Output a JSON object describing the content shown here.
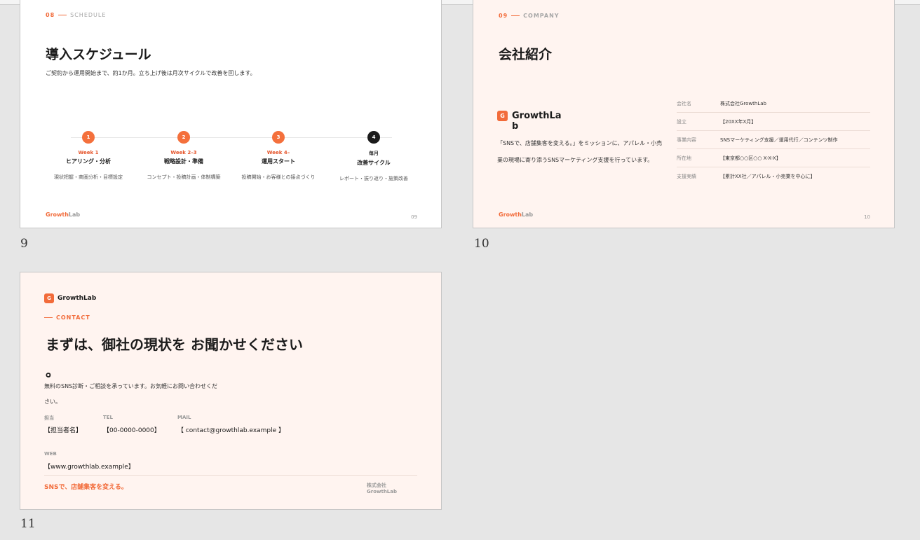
{
  "slide9": {
    "number": "9",
    "section_num": "08",
    "section_label": "SCHEDULE",
    "title": "導入スケジュール",
    "subtitle": "ご契約から運用開始まで、約1か月。立ち上げ後は月次サイクルで改善を回します。",
    "steps": [
      {
        "num": "1",
        "week": "Week 1",
        "name": "ヒアリング・分析",
        "desc": "現状把握・商圏分析・目標設定"
      },
      {
        "num": "2",
        "week": "Week 2–3",
        "name": "戦略設計・準備",
        "desc": "コンセプト・投稿計画・体制構築"
      },
      {
        "num": "3",
        "week": "Week 4–",
        "name": "運用スタート",
        "desc": "投稿開始・お客様との接点づくり"
      },
      {
        "num": "4",
        "week": "毎月",
        "name": "改善サイクル",
        "desc": "レポート・振り返り・施策改善"
      }
    ],
    "brand_a": "Growth",
    "brand_b": "Lab",
    "page": "09"
  },
  "slide10": {
    "number": "10",
    "section_num": "09",
    "section_label": "COMPANY",
    "title": "会社紹介",
    "logo_letter": "G",
    "company_name_line1": "GrowthLa",
    "company_name_line2": "b",
    "description": "「SNSで、店舗集客を変える。」をミッションに、アパレル・小売業の現場に寄り添うSNSマーケティング支援を行っています。",
    "rows": [
      {
        "key": "会社名",
        "value": "株式会社GrowthLab"
      },
      {
        "key": "設立",
        "value": "【20XX年X月】"
      },
      {
        "key": "事業内容",
        "value": "SNSマーケティング支援／運用代行／コンテンツ制作"
      },
      {
        "key": "所在地",
        "value": "【東京都○○区○○ X-X-X】"
      },
      {
        "key": "支援実績",
        "value": "【累計XX社／アパレル・小売業を中心に】"
      }
    ],
    "brand_a": "Growth",
    "brand_b": "Lab",
    "page": "10"
  },
  "slide11": {
    "number": "11",
    "logo_letter": "G",
    "logo_name": "GrowthLab",
    "section_label": "CONTACT",
    "title_line1": "まずは、御社の現状を お聞かせください",
    "title_line2": "。",
    "desc_line1": "無料のSNS診断・ご相談を承っています。お気軽にお問い合わせくだ",
    "desc_line2": "さい。",
    "contacts": {
      "person_label": "担当",
      "person_value": "【担当者名】",
      "tel_label": "TEL",
      "tel_value": "【00-0000-0000】",
      "mail_label": "MAIL",
      "mail_value": "【 contact@growthlab.example 】",
      "web_label": "WEB",
      "web_value": "【www.growthlab.example】"
    },
    "tagline": "SNSで、店舗集客を変える。",
    "company_line1": "株式会社",
    "company_line2": "GrowthLab"
  },
  "colors": {
    "accent": "#f26b3a",
    "peach_bg": "#fff4f0",
    "dark": "#1b1b1b"
  }
}
